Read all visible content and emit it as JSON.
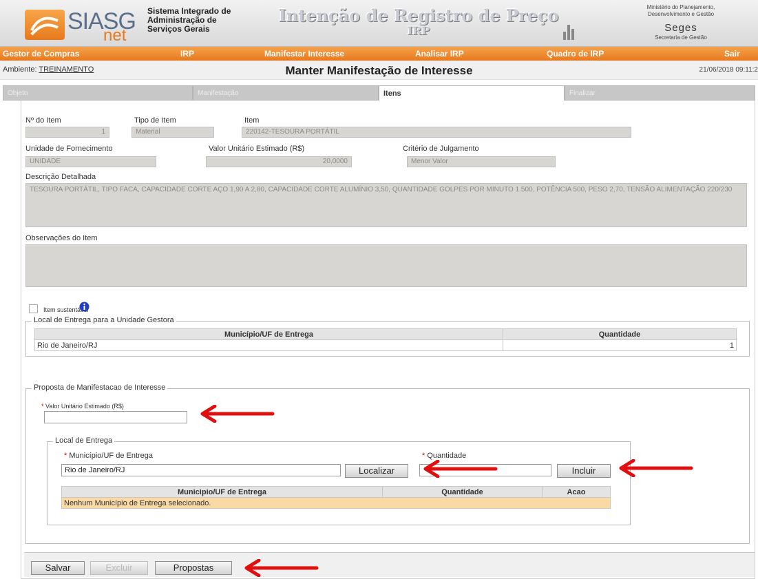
{
  "header": {
    "logo_main": "SIASG",
    "logo_sub": "net",
    "system_name": [
      "Sistema Integrado de",
      "Administração de",
      "Serviços Gerais"
    ],
    "banner_line1": "Intenção de Registro de Preço",
    "banner_line2": "IRP",
    "ministry_line1": "Ministério do Planejamento,",
    "ministry_line2": "Desenvolvimento e Gestão",
    "segs": "Seges",
    "segs_sub": "Secretaria de Gestão"
  },
  "menu": {
    "items": [
      "Gestor de Compras",
      "IRP",
      "Manifestar Interesse",
      "Analisar IRP",
      "Quadro de IRP",
      "Sair"
    ]
  },
  "titlebar": {
    "ambiente_label": "Ambiente: ",
    "ambiente_value": "TREINAMENTO",
    "title": "Manter Manifestação de Interesse",
    "datetime": "21/06/2018 09:11:2"
  },
  "tabs": [
    "Objeto",
    "Manifestação",
    "Itens",
    "Finalizar"
  ],
  "item": {
    "num_label": "Nº do Item",
    "num_value": "1",
    "tipo_label": "Tipo de Item",
    "tipo_value": "Material",
    "item_label": "Item",
    "item_value": "220142-TESOURA PORTÁTIL",
    "unidade_label": "Unidade de Fornecimento",
    "unidade_value": "UNIDADE",
    "valor_label": "Valor Unitário Estimado (R$)",
    "valor_value": "20,0000",
    "criterio_label": "Critério de Julgamento",
    "criterio_value": "Menor Valor",
    "descricao_label": "Descrição Detalhada",
    "descricao_value": "TESOURA PORTÁTIL, TIPO FACA, CAPACIDADE CORTE AÇO 1,90 A 2,80, CAPACIDADE CORTE ALUMÍNIO 3,50, QUANTIDADE GOLPES POR MINUTO 1.500, POTÊNCIA 500, PESO 2,70, TENSÃO ALIMENTAÇÃO 220/230",
    "obs_label": "Observações do Item",
    "obs_value": "",
    "sustentavel_label": "Item sustentável"
  },
  "local_gestora": {
    "legend": "Local de Entrega para a Unidade Gestora",
    "headers": [
      "Município/UF de Entrega",
      "Quantidade"
    ],
    "rows": [
      [
        "Rio de Janeiro/RJ",
        "1"
      ]
    ]
  },
  "proposta": {
    "legend": "Proposta de Manifestacao de Interesse",
    "valor_label": "Valor Unitário Estimado (R$)",
    "valor_value": "",
    "local": {
      "legend": "Local de Entrega",
      "municipio_label": "Município/UF de Entrega",
      "municipio_value": "Rio de Janeiro/RJ",
      "localizar_label": "Localizar",
      "quantidade_label": "Quantidade",
      "quantidade_value": "",
      "incluir_label": "Incluir",
      "headers": [
        "Municipio/UF de Entrega",
        "Quantidade",
        "Acao"
      ],
      "empty_message": "Nenhum Município de Entrega selecionado."
    }
  },
  "footer": {
    "salvar": "Salvar",
    "excluir": "Excluir",
    "propostas": "Propostas"
  },
  "colors": {
    "orange": "#e8791d",
    "annotation_arrow": "#e01010"
  }
}
